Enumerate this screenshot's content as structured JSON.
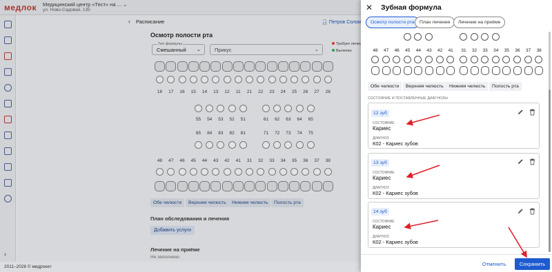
{
  "app": {
    "logo": "медлок",
    "clinic_name": "Медицинский центр «Тест» на ...",
    "clinic_address": "ул. Ново-Садовая, 135",
    "footer": "2011–2026 © медрокет"
  },
  "background": {
    "breadcrumb": "Расписание",
    "doctor": "Петров Соломон Ф...",
    "exam_title": "Осмотр полости рта",
    "formula_type_label": "Тип формулы",
    "formula_type_value": "Смешанный",
    "bite_placeholder": "Прикус",
    "legend": [
      "Требует лечения",
      "Вылечен"
    ],
    "upper_permanent": [
      "18",
      "17",
      "16",
      "15",
      "14",
      "13",
      "12",
      "11",
      "21",
      "22",
      "23",
      "24",
      "25",
      "26",
      "27",
      "28"
    ],
    "upper_milk": [
      "55",
      "54",
      "53",
      "52",
      "51",
      "61",
      "62",
      "63",
      "64",
      "65"
    ],
    "lower_milk": [
      "85",
      "84",
      "83",
      "82",
      "81",
      "71",
      "72",
      "73",
      "74",
      "75"
    ],
    "lower_permanent": [
      "48",
      "47",
      "46",
      "45",
      "44",
      "43",
      "42",
      "41",
      "31",
      "32",
      "33",
      "34",
      "35",
      "36",
      "37",
      "38"
    ],
    "jaw_tabs": [
      "Обе челюсти",
      "Верхняя челюсть",
      "Нижняя челюсть",
      "Полость рта"
    ],
    "plan_title": "План обследования и лечения",
    "add_services": "Добавить услуги",
    "reception_title": "Лечение на приёме",
    "not_filled": "Не заполнено"
  },
  "panel": {
    "title": "Зубная формула",
    "tabs": [
      "Осмотр полости рта",
      "План лечения",
      "Лечение на приёме"
    ],
    "lower_teeth": [
      "48",
      "47",
      "46",
      "45",
      "44",
      "43",
      "42",
      "41",
      "31",
      "32",
      "33",
      "34",
      "35",
      "36",
      "37",
      "38"
    ],
    "jaw_tabs": [
      "Обе челюсти",
      "Верхняя челюсть",
      "Нижняя челюсть",
      "Полость рта"
    ],
    "conditions_header": "СОСТОЯНИЕ И ПОСТАВЛЕННЫЕ ДИАГНОЗЫ",
    "cards": [
      {
        "tooth": "12 зуб",
        "state_label": "СОСТОЯНИЕ",
        "state": "Кариес",
        "diag_label": "ДИАГНОЗ",
        "diagnosis": "К02 - Кариес зубов"
      },
      {
        "tooth": "13 зуб",
        "state_label": "СОСТОЯНИЕ",
        "state": "Кариес",
        "diag_label": "ДИАГНОЗ",
        "diagnosis": "К02 - Кариес зубов"
      },
      {
        "tooth": "14 зуб",
        "state_label": "СОСТОЯНИЕ",
        "state": "Кариес",
        "diag_label": "ДИАГНОЗ",
        "diagnosis": "К02 - Кариес зубов"
      }
    ],
    "cancel": "Отменить",
    "save": "Сохранить"
  },
  "colors": {
    "accent": "#1e5bd0",
    "arrow": "#e0202a",
    "needs_treatment": "#d9362b",
    "treated": "#2e9c4a"
  }
}
